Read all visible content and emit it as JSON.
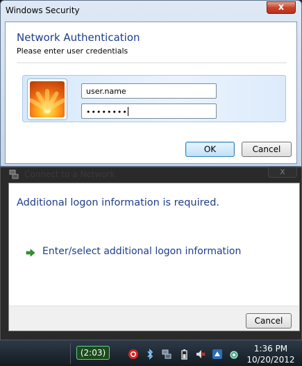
{
  "security_dialog": {
    "title": "Windows Security",
    "close_glyph": "x",
    "heading": "Network Authentication",
    "subheading": "Please enter user credentials",
    "username_value": "user.name",
    "password_mask": "••••••••",
    "ok_label": "OK",
    "cancel_label": "Cancel",
    "avatar_icon": "flower-user-picture-icon"
  },
  "network_dialog": {
    "title": "Connect to a Network",
    "close_glyph": "x",
    "heading": "Additional logon information is required.",
    "link_label": "Enter/select additional logon information",
    "cancel_label": "Cancel",
    "title_icon": "network-icon",
    "link_icon": "green-arrow-icon"
  },
  "taskbar": {
    "battery_time": "(2:03)",
    "clock_time": "1:36 PM",
    "clock_date": "10/20/2012",
    "tray_icons": [
      "red-circle-app-icon",
      "bluetooth-icon",
      "network-wired-icon",
      "battery-icon",
      "speaker-muted-icon",
      "app-icon",
      "network-status-icon"
    ]
  },
  "colors": {
    "heading_blue": "#1e3e8a",
    "close_red": "#c7452c",
    "taskbar_dark": "#141b22"
  }
}
